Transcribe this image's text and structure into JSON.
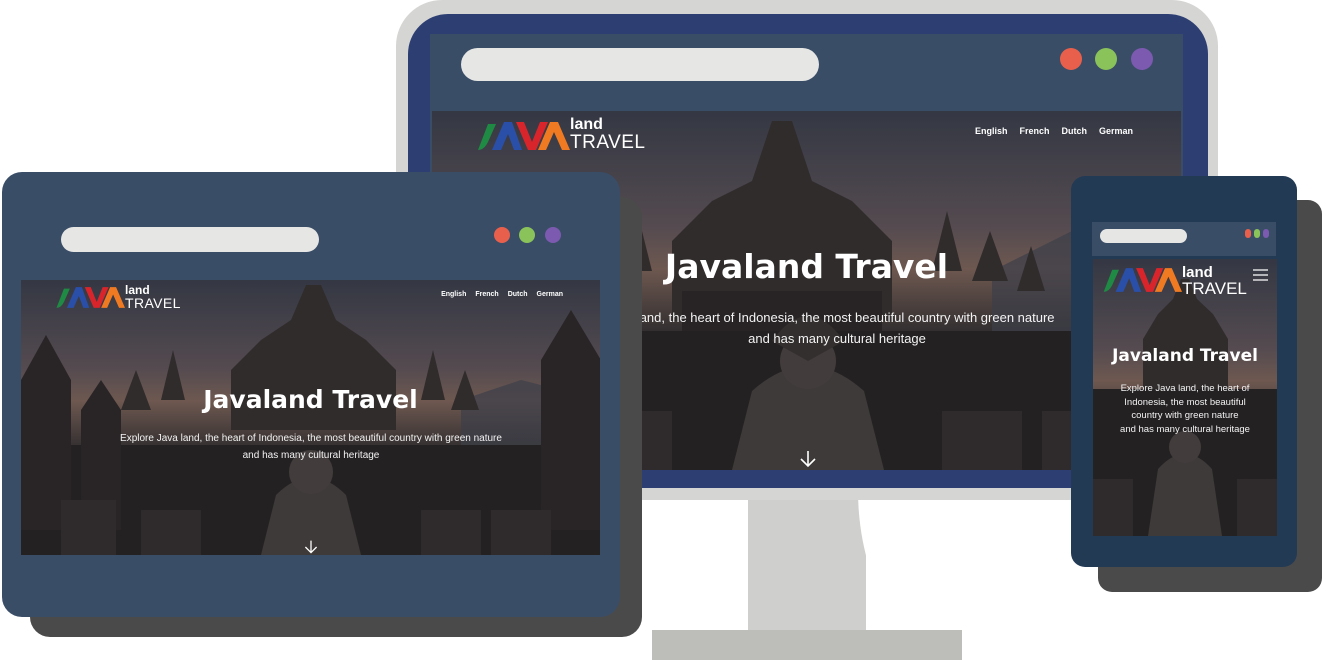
{
  "site": {
    "title": "Javaland Travel",
    "subtitle_wide": "Explore Java land, the heart of Indonesia, the most beautiful country with green nature and has many cultural heritage",
    "subtitle_monitor_visible": "va land, the heart of Indonesia, the most beautiful country with green nature and has many cultural heritage",
    "subtitle_phone_lines": [
      "Explore Java land, the heart of",
      "Indonesia, the most beautiful",
      "country with green nature",
      "and has many cultural heritage"
    ],
    "languages": [
      "English",
      "French",
      "Dutch",
      "German"
    ],
    "logo": {
      "land": "land",
      "travel": "TRAVEL",
      "mark_letters": "JAVA"
    }
  },
  "window_controls": {
    "colors": [
      "#e8604c",
      "#8ac35a",
      "#7b5ab0"
    ]
  },
  "icons": {
    "scroll": "arrow-down-icon",
    "menu": "hamburger-menu-icon"
  },
  "colors": {
    "logo_green": "#1f8a43",
    "logo_blue": "#2a4fa8",
    "logo_red": "#d8252c",
    "logo_orange": "#f07a22",
    "device_frame": "#3a4d67",
    "monitor_frame": "#2d3e73"
  }
}
